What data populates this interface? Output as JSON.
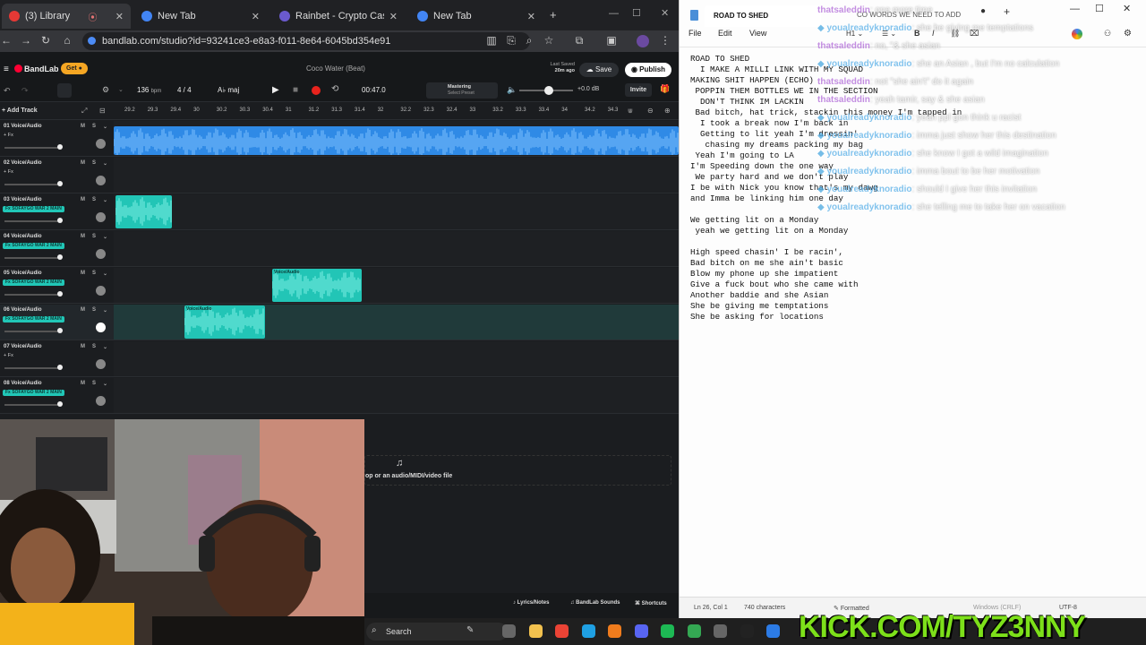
{
  "tabs": [
    {
      "label": "(3) Library",
      "color": "#e53935"
    },
    {
      "label": "New Tab",
      "color": "#4285f4"
    },
    {
      "label": "Rainbet - Crypto Casino & Sp",
      "color": "#6a5acd"
    },
    {
      "label": "New Tab",
      "color": "#4285f4"
    }
  ],
  "address": {
    "url": "bandlab.com/studio?id=93241ce3-e8a3-f011-8e64-6045bd354e91"
  },
  "bandlab": {
    "brand": "BandLab",
    "get_label": "Get",
    "song_title": "Coco Water (Beat)",
    "last_saved": "Last Saved",
    "saved_ago": "20m ago",
    "save_label": "Save",
    "publish_label": "Publish",
    "bpm": "136",
    "bpm_unit": "bpm",
    "time_sig": "4 / 4",
    "key": "maj",
    "time": "00:47.0",
    "mastering": "Mastering",
    "select_preset": "Select Preset",
    "volume_db": "+0.0 dB",
    "invite": "Invite",
    "add_track": "Add Track",
    "ruler": [
      "29.2",
      "29.3",
      "29.4",
      "30",
      "30.2",
      "30.3",
      "30.4",
      "31",
      "31.2",
      "31.3",
      "31.4",
      "32",
      "32.2",
      "32.3",
      "32.4",
      "33",
      "33.2",
      "33.3",
      "33.4",
      "34",
      "34.2",
      "34.3"
    ],
    "tracks": [
      {
        "name": "01 Voice/Audio",
        "fx": "+ Fx"
      },
      {
        "name": "02 Voice/Audio",
        "fx": "+ Fx"
      },
      {
        "name": "03 Voice/Audio",
        "fx": "Fx SOFAYGO WAR 2 MAIN"
      },
      {
        "name": "04 Voice/Audio",
        "fx": "Fx SOFAYGO WAR 2 MAIN"
      },
      {
        "name": "05 Voice/Audio",
        "fx": "Fx SOFAYGO WAR 2 MAIN"
      },
      {
        "name": "06 Voice/Audio",
        "fx": "Fx SOFAYGO WAR 2 MAIN"
      },
      {
        "name": "07 Voice/Audio",
        "fx": "+ Fx"
      },
      {
        "name": "08 Voice/Audio",
        "fx": "Fx SOFAYGO WAR 2 MAIN"
      }
    ],
    "clip_label": "Voice/Audio",
    "drop_text": "op or an audio/MIDI/video file",
    "footer": [
      "Lyrics/Notes",
      "BandLab Sounds",
      "Shortcuts"
    ]
  },
  "notepad": {
    "title": "ROAD TO SHED",
    "menu": [
      "File",
      "Edit",
      "View"
    ],
    "lyrics": "ROAD TO SHED\n  I MAKE A MILLI LINK WITH MY SQUAD\nMAKING SHIT HAPPEN (ECHO)\n POPPIN THEM BOTTLES WE IN THE SECTION\n  DON'T THINK IM LACKIN\n Bad bitch, hat trick, stackin this money I'm tapped in\n  I took a break now I'm back in\n  Getting to lit yeah I'm dressin'\n   chasing my dreams packing my bag\n Yeah I'm going to LA\nI'm Speeding down the one way\n We party hard and we don't play\nI be with Nick you know that's my dawg\nand Imma be linking him one day\n\nWe getting lit on a Monday\n yeah we getting lit on a Monday\n\nHigh speed chasin' I be racin',\nBad bitch on me she ain't basic\nBlow my phone up she impatient\nGive a fuck bout who she came with\nAnother baddie and she Asian\nShe be giving me temptations\nShe be asking for locations",
    "status_pos": "Ln 26, Col 1",
    "status_chars": "740 characters",
    "status_format": "Formatted",
    "status_eol": "Windows (CRLF)",
    "status_enc": "UTF-8"
  },
  "chat": [
    {
      "user": "thatsaleddin",
      "text": ": one more time"
    },
    {
      "user": "youalreadyknoradio",
      "text": ": she be giving me temptations"
    },
    {
      "user": "thatsaleddin",
      "text": ": no, \"& she asian"
    },
    {
      "user": "youalreadyknoradio",
      "text": ": she an Asian , but I'm no calculation"
    },
    {
      "user": "thatsaleddin",
      "text": ": not \"she ain't\" do it again"
    },
    {
      "user": "thatsaleddin",
      "text": ": yeah tamir, say & she asian"
    },
    {
      "user": "youalreadyknoradio",
      "text": ": yeah ppl gon think u racist"
    },
    {
      "user": "youalreadyknoradio",
      "text": ": imma just show her this destination"
    },
    {
      "user": "youalreadyknoradio",
      "text": ": she know I got a wild imagination"
    },
    {
      "user": "youalreadyknoradio",
      "text": ": imma bout to be her motivation"
    },
    {
      "user": "youalreadyknoradio",
      "text": ": should I give her this invitation"
    },
    {
      "user": "youalreadyknoradio",
      "text": ": she telling me to take her on vacation"
    }
  ],
  "chat_overlay_title": "CO WORDS WE NEED TO ADD",
  "watermark": "KICK.COM/TYZ3NNY",
  "taskbar": {
    "search": "Search"
  }
}
